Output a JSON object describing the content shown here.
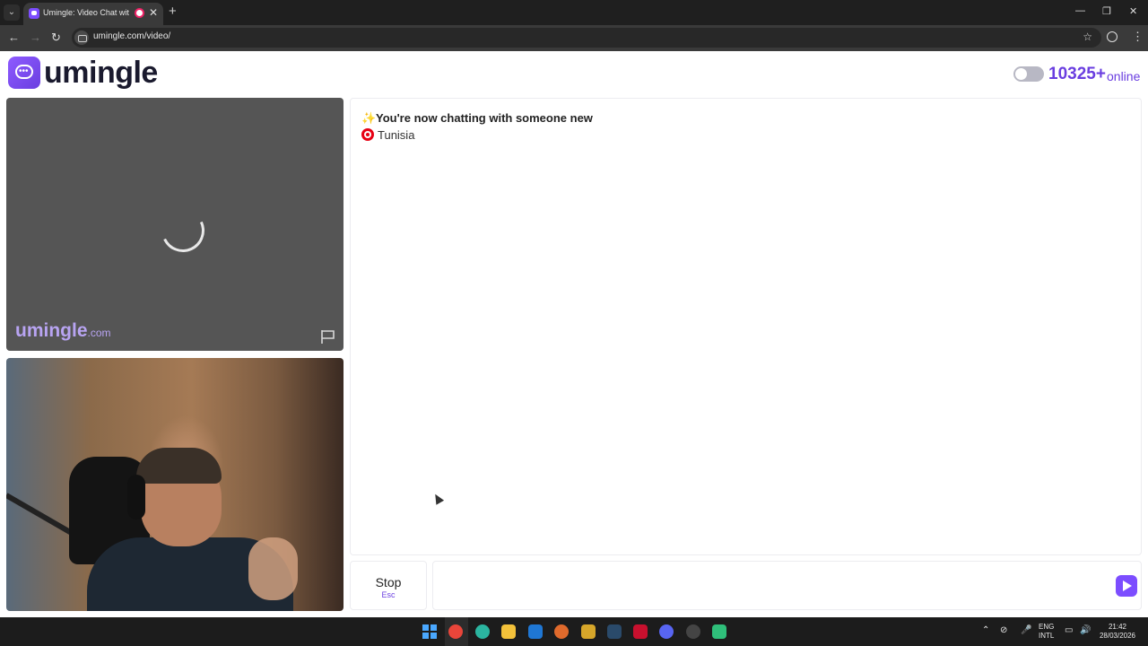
{
  "browser": {
    "tab_title": "Umingle: Video Chat with S",
    "url": "umingle.com/video/",
    "new_tab_glyph": "+",
    "tab_close_glyph": "✕"
  },
  "header": {
    "logo_text": "umingle",
    "online_count": "10325+",
    "online_label": "online",
    "toggle_state": "off"
  },
  "remote_video": {
    "watermark_main": "umingle",
    "watermark_suffix": ".com",
    "status": "loading"
  },
  "chat": {
    "messages": [
      {
        "icon": "sparkles-icon",
        "text": "You're now chatting with someone new"
      },
      {
        "icon": "flag-tunisia-icon",
        "text": "Tunisia"
      }
    ],
    "input_value": "",
    "input_placeholder": ""
  },
  "controls": {
    "stop_label": "Stop",
    "stop_shortcut": "Esc"
  },
  "taskbar": {
    "language_line1": "ENG",
    "language_line2": "INTL",
    "time": "21:42",
    "date": "28/03/2026"
  },
  "colors": {
    "brand": "#7c4dff",
    "brand_dark": "#6a3ee0",
    "chrome_bg": "#1f1f1f",
    "video_bg": "#555555"
  }
}
